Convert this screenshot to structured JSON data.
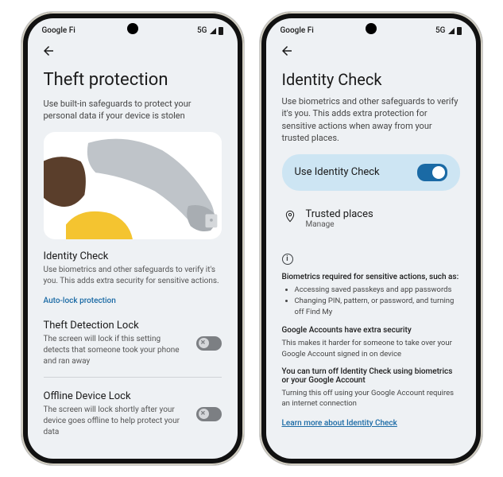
{
  "status": {
    "carrier": "Google Fi",
    "network": "5G"
  },
  "left": {
    "title": "Theft protection",
    "subtitle": "Use built-in safeguards to protect your personal data if your device is stolen",
    "identity": {
      "title": "Identity Check",
      "desc": "Use biometrics and other safeguards to verify it's you. This adds extra security for sensitive actions."
    },
    "autolock_link": "Auto-lock protection",
    "theft_lock": {
      "title": "Theft Detection Lock",
      "desc": "The screen will lock if this setting detects that someone took your phone and ran away"
    },
    "offline_lock": {
      "title": "Offline Device Lock",
      "desc": "The screen will lock shortly after your device goes offline to help protect your data"
    }
  },
  "right": {
    "title": "Identity Check",
    "subtitle": "Use biometrics and other safeguards to verify it's you. This adds extra protection for sensitive actions when away from your trusted places.",
    "toggle_label": "Use Identity Check",
    "trusted": {
      "title": "Trusted places",
      "sub": "Manage"
    },
    "info": {
      "biometrics_heading": "Biometrics required for sensitive actions, such as:",
      "bullets": [
        "Accessing saved passkeys and app passwords",
        "Changing PIN, pattern, or password, and turning off Find My"
      ],
      "google_heading": "Google Accounts have extra security",
      "google_body": "This makes it harder for someone to take over your Google Account signed in on device",
      "turnoff_heading": "You can turn off Identity Check using biometrics or your Google Account",
      "turnoff_body": "Turning this off using your Google Account requires an internet connection",
      "learn_link": "Learn more about Identity Check"
    }
  }
}
